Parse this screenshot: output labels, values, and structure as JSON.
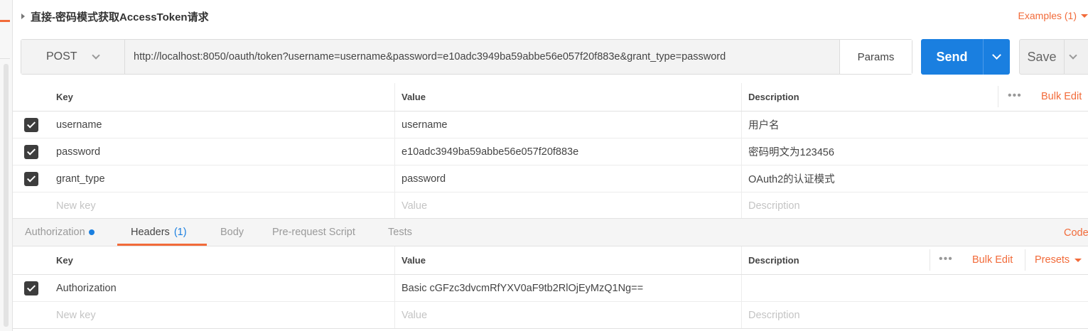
{
  "request": {
    "title": "直接-密码模式获取AccessToken请求",
    "examples_label": "Examples (1)",
    "method": "POST",
    "url": "http://localhost:8050/oauth/token?username=username&password=e10adc3949ba59abbe56e057f20f883e&grant_type=password",
    "params_label": "Params",
    "send_label": "Send",
    "save_label": "Save"
  },
  "params_table": {
    "headers": {
      "key": "Key",
      "value": "Value",
      "description": "Description"
    },
    "bulk_edit": "Bulk Edit",
    "rows": [
      {
        "checked": true,
        "key": "username",
        "value": "username",
        "description": "用户名"
      },
      {
        "checked": true,
        "key": "password",
        "value": "e10adc3949ba59abbe56e057f20f883e",
        "description": "密码明文为123456"
      },
      {
        "checked": true,
        "key": "grant_type",
        "value": "password",
        "description": "OAuth2的认证模式"
      }
    ],
    "new_row": {
      "key": "New key",
      "value": "Value",
      "description": "Description"
    }
  },
  "tabs": {
    "items": [
      {
        "label": "Authorization",
        "indicator": true
      },
      {
        "label": "Headers",
        "count": "(1)",
        "active": true
      },
      {
        "label": "Body"
      },
      {
        "label": "Pre-request Script"
      },
      {
        "label": "Tests"
      }
    ],
    "code_link": "Code"
  },
  "headers_table": {
    "headers": {
      "key": "Key",
      "value": "Value",
      "description": "Description"
    },
    "bulk_edit": "Bulk Edit",
    "presets": "Presets",
    "rows": [
      {
        "checked": true,
        "key": "Authorization",
        "value": "Basic cGFzc3dvcmRfYXV0aF9tb2RlOjEyMzQ1Ng==",
        "description": ""
      }
    ],
    "new_row": {
      "key": "New key",
      "value": "Value",
      "description": "Description"
    }
  },
  "colors": {
    "accent": "#f26b3a",
    "primary": "#1a7fe0"
  }
}
